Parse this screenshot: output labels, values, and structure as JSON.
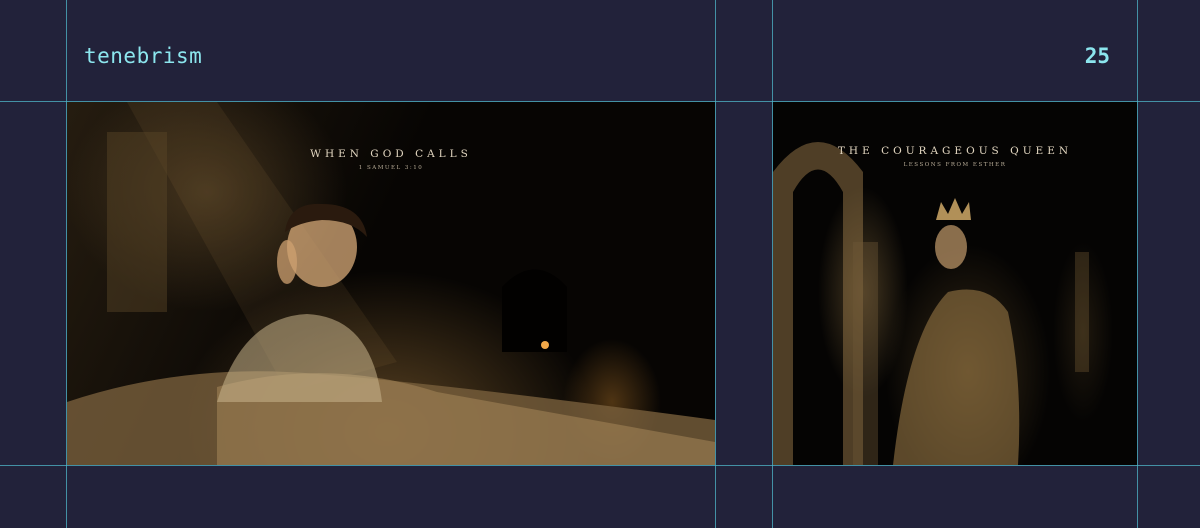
{
  "header": {
    "title": "tenebrism",
    "page_number": "25"
  },
  "colors": {
    "background": "#22223a",
    "guide_lines": "#4fb7c9",
    "header_text": "#8ce6ee",
    "caption_text": "#e2d6c0"
  },
  "panels": [
    {
      "caption_title": "WHEN GOD CALLS",
      "caption_subtitle": "1 SAMUEL 3:10"
    },
    {
      "caption_title": "THE COURAGEOUS QUEEN",
      "caption_subtitle": "LESSONS FROM ESTHER"
    }
  ]
}
